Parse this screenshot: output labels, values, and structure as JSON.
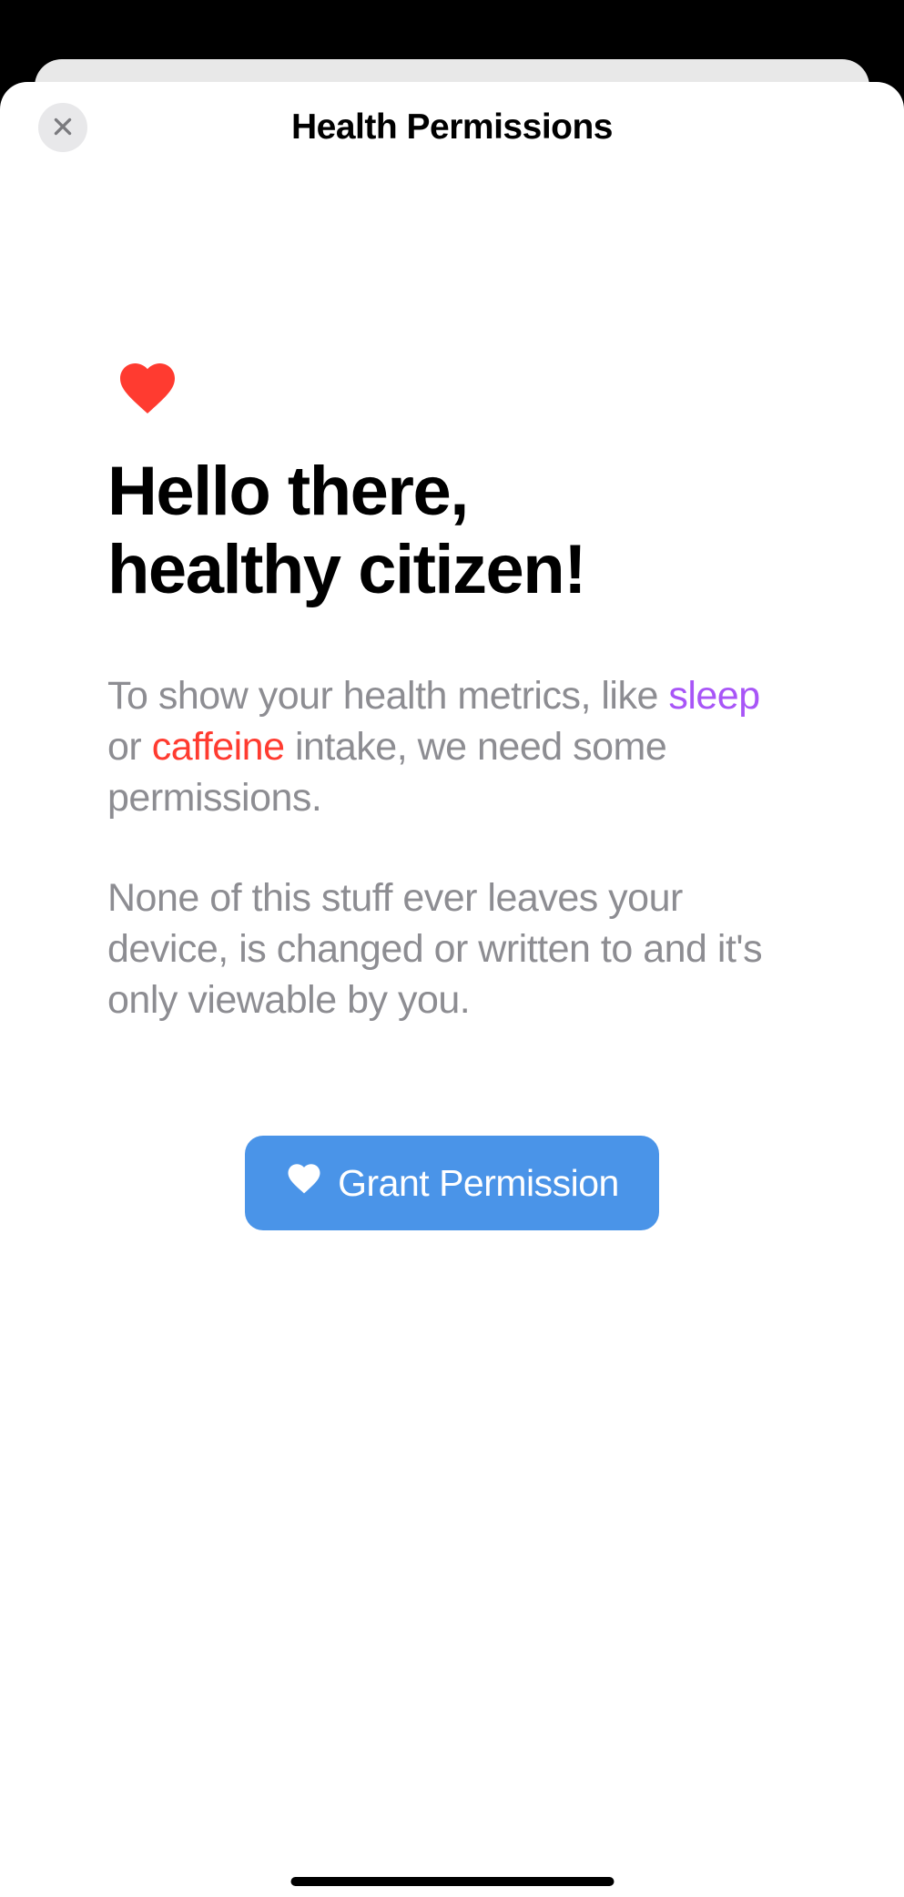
{
  "header": {
    "title": "Health Permissions"
  },
  "content": {
    "heading_line1": "Hello there,",
    "heading_line2": "healthy citizen!",
    "body_intro_pre": "To show your health metrics, like ",
    "body_highlight_sleep": "sleep",
    "body_intro_mid": " or ",
    "body_highlight_caffeine": "caffeine",
    "body_intro_post": " intake, we need some permissions.",
    "body_privacy": "None of this stuff ever leaves your device, is changed or written to and it's only viewable by you."
  },
  "button": {
    "grant_label": "Grant Permission"
  },
  "colors": {
    "highlight_purple": "#a855f7",
    "highlight_red": "#ff3b30",
    "button_bg": "#4a94e8"
  }
}
